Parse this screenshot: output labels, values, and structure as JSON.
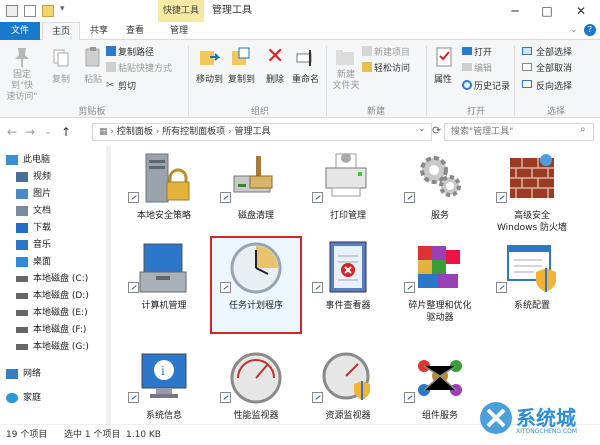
{
  "window": {
    "title": "管理工具",
    "context_tab": "快捷工具"
  },
  "ribbon_tabs": {
    "file": "文件",
    "home": "主页",
    "share": "共享",
    "view": "查看",
    "manage": "管理"
  },
  "ribbon": {
    "clipboard": {
      "pin": "固定到\"快\n速访问\"",
      "copy": "复制",
      "paste": "粘贴",
      "copy_path": "复制路径",
      "paste_shortcut": "粘贴快捷方式",
      "cut": "剪切",
      "group": "剪贴板"
    },
    "organize": {
      "move_to": "移动到",
      "copy_to": "复制到",
      "delete": "删除",
      "rename": "重命名",
      "group": "组织"
    },
    "new": {
      "new_folder": "新建\n文件夹",
      "new_item": "新建项目",
      "easy_access": "轻松访问",
      "group": "新建"
    },
    "open": {
      "properties": "属性",
      "open": "打开",
      "edit": "编辑",
      "history": "历史记录",
      "group": "打开"
    },
    "select": {
      "select_all": "全部选择",
      "select_none": "全部取消",
      "invert": "反向选择",
      "group": "选择"
    }
  },
  "nav": {
    "breadcrumb": [
      "控制面板",
      "所有控制面板项",
      "管理工具"
    ],
    "search_placeholder": "搜索\"管理工具\""
  },
  "sidebar": [
    {
      "label": "此电脑",
      "icon": "computer-icon",
      "color": "#3c8fd6"
    },
    {
      "label": "视频",
      "icon": "video-icon",
      "color": "#4a6e9a"
    },
    {
      "label": "图片",
      "icon": "picture-icon",
      "color": "#4a8ac8"
    },
    {
      "label": "文档",
      "icon": "document-icon",
      "color": "#7a8aa0"
    },
    {
      "label": "下载",
      "icon": "download-icon",
      "color": "#1f6fc7"
    },
    {
      "label": "音乐",
      "icon": "music-icon",
      "color": "#2b76c9"
    },
    {
      "label": "桌面",
      "icon": "desktop-icon",
      "color": "#2f8ad8"
    },
    {
      "label": "本地磁盘 (C:)",
      "icon": "drive-icon",
      "color": "#666666"
    },
    {
      "label": "本地磁盘 (D:)",
      "icon": "drive-icon",
      "color": "#666666"
    },
    {
      "label": "本地磁盘 (E:)",
      "icon": "drive-icon",
      "color": "#666666"
    },
    {
      "label": "本地磁盘 (F:)",
      "icon": "drive-icon",
      "color": "#666666"
    },
    {
      "label": "本地磁盘 (G:)",
      "icon": "drive-icon",
      "color": "#666666"
    },
    {
      "label": "网络",
      "icon": "network-icon",
      "color": "#3a7cc4"
    },
    {
      "label": "家庭",
      "icon": "homegroup-icon",
      "color": "#2a9ad6"
    }
  ],
  "items": [
    {
      "label": "本地安全策略",
      "icon": "local-security-policy-icon"
    },
    {
      "label": "磁盘清理",
      "icon": "disk-cleanup-icon"
    },
    {
      "label": "打印管理",
      "icon": "print-management-icon"
    },
    {
      "label": "服务",
      "icon": "services-icon"
    },
    {
      "label": "高级安全\nWindows 防火墙",
      "icon": "firewall-icon"
    },
    {
      "label": "计算机管理",
      "icon": "computer-management-icon"
    },
    {
      "label": "任务计划程序",
      "icon": "task-scheduler-icon",
      "selected": true
    },
    {
      "label": "事件查看器",
      "icon": "event-viewer-icon"
    },
    {
      "label": "碎片整理和优化\n驱动器",
      "icon": "defragment-icon"
    },
    {
      "label": "系统配置",
      "icon": "system-configuration-icon"
    },
    {
      "label": "系统信息",
      "icon": "system-information-icon"
    },
    {
      "label": "性能监视器",
      "icon": "performance-monitor-icon"
    },
    {
      "label": "资源监视器",
      "icon": "resource-monitor-icon"
    },
    {
      "label": "组件服务",
      "icon": "component-services-icon"
    }
  ],
  "status": {
    "count": "19 个项目",
    "selected": "选中 1 个项目",
    "size": "1.10 KB"
  },
  "watermark": {
    "text": "系统城",
    "subtext": "XITONGCHENG.COM"
  },
  "colors": {
    "accent": "#1979ca",
    "context_tab": "#f6e8a5",
    "selection_border": "#d8232a"
  }
}
